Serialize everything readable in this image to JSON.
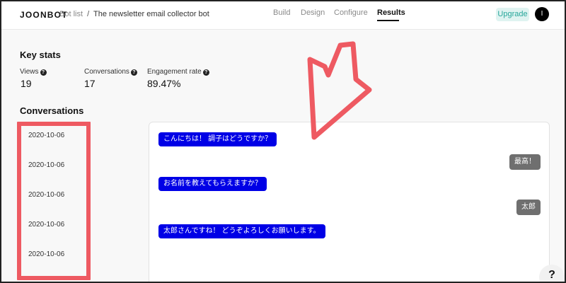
{
  "header": {
    "logo": "JOONBOT",
    "breadcrumb": {
      "parent": "Bot list",
      "separator": "/",
      "current": "The newsletter email collector bot"
    },
    "tabs": [
      {
        "label": "Build",
        "active": false
      },
      {
        "label": "Design",
        "active": false
      },
      {
        "label": "Configure",
        "active": false
      },
      {
        "label": "Results",
        "active": true
      }
    ],
    "upgrade_label": "Upgrade",
    "avatar_initial": "I"
  },
  "key_stats": {
    "title": "Key stats",
    "items": [
      {
        "label": "Views",
        "value": "19",
        "help_icon": "question-icon"
      },
      {
        "label": "Conversations",
        "value": "17",
        "help_icon": "question-icon"
      },
      {
        "label": "Engagement rate",
        "value": "89.47%",
        "help_icon": "question-icon"
      }
    ]
  },
  "conversations": {
    "title": "Conversations",
    "dates": [
      "2020-10-06",
      "2020-10-06",
      "2020-10-06",
      "2020-10-06",
      "2020-10-06"
    ]
  },
  "chat": {
    "messages": [
      {
        "from": "bot",
        "text": "こんにちは！ 調子はどうですか？"
      },
      {
        "from": "user",
        "text": "最高！"
      },
      {
        "from": "bot",
        "text": "お名前を教えてもらえますか？"
      },
      {
        "from": "user",
        "text": "太郎"
      },
      {
        "from": "bot",
        "text": "太郎さんですね！ どうぞよろしくお願いします。"
      }
    ]
  },
  "help_button": {
    "label": "?"
  },
  "annotation": {
    "highlight_color": "#ee5a62",
    "arrow_color": "#ee5a62"
  },
  "colors": {
    "bot_bubble": "#0000e6",
    "user_bubble": "#6f6f6f",
    "upgrade_text": "#26a69a"
  }
}
